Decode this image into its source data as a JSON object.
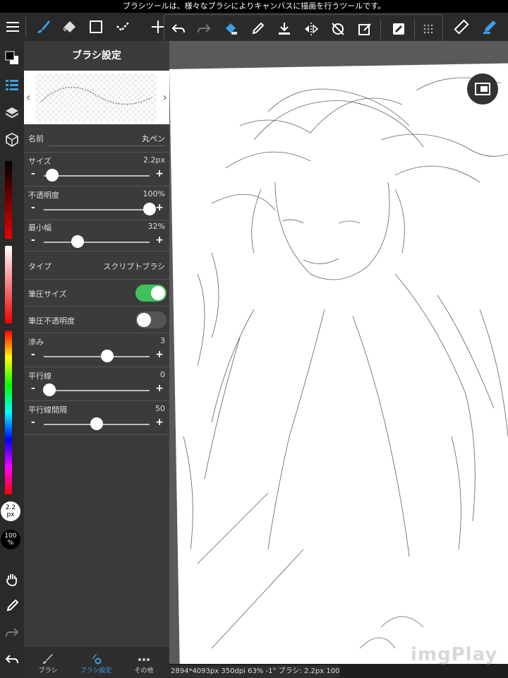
{
  "status_text": "ブラシツールは、様々なブラシによりキャンバスに描画を行うツールです。",
  "panel": {
    "title": "ブラシ設定",
    "name_label": "名前",
    "name_value": "丸ペン",
    "size_label": "サイズ",
    "size_value": "2.2px",
    "size_level": 0.08,
    "opacity_label": "不透明度",
    "opacity_value": "100%",
    "opacity_level": 1.0,
    "min_width_label": "最小幅",
    "min_width_value": "32%",
    "min_width_level": 0.32,
    "type_label": "タイプ",
    "type_value": "スクリプトブラシ",
    "pressure_size_label": "筆圧サイズ",
    "pressure_size_on": true,
    "pressure_opacity_label": "筆圧不透明度",
    "pressure_opacity_on": false,
    "blur_label": "滲み",
    "blur_value": "3",
    "blur_level": 0.6,
    "parallel_label": "平行線",
    "parallel_value": "0",
    "parallel_level": 0.05,
    "parallel_spacing_label": "平行線間隔",
    "parallel_spacing_value": "50",
    "parallel_spacing_level": 0.5,
    "prev_arrow": "‹",
    "next_arrow": "›",
    "minus": "-",
    "plus": "+"
  },
  "tabs": {
    "brush": "ブラシ",
    "brush_settings": "ブラシ設定",
    "other": "その他"
  },
  "leftbar": {
    "size_bubble_line1": "2.2",
    "size_bubble_line2": "px",
    "opacity_bubble_line1": "100",
    "opacity_bubble_line2": "%"
  },
  "info_text": "2894*4093px 350dpi 63% -1° ブラシ: 2.2px 100%",
  "watermark": "imgPlay",
  "colors": {
    "accent": "#3aa0e8",
    "toggle_on": "#3ec25a",
    "toggle_off": "#555555",
    "panel_bg": "#3b3b3b"
  },
  "icons": {
    "menu": "menu-icon",
    "brush": "brush-icon",
    "eraser": "eraser-icon",
    "select": "select-rect-icon",
    "magic": "check-icon",
    "move": "move-icon",
    "undo": "undo-icon",
    "redo": "redo-icon",
    "fill": "bucket-icon",
    "picker": "eyedropper-icon",
    "download": "download-icon",
    "flip": "flip-icon",
    "rotate": "rotate-off-icon",
    "edit": "edit-icon",
    "snap": "snap-icon",
    "grid": "grid-icon",
    "ruler": "ruler-icon",
    "pen": "pen-icon"
  }
}
